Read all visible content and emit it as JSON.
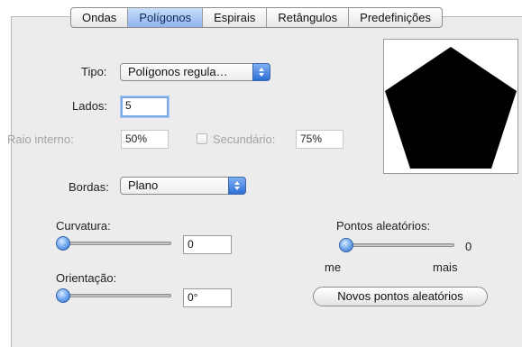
{
  "tabs": [
    {
      "label": "Ondas"
    },
    {
      "label": "Polígonos"
    },
    {
      "label": "Espirais"
    },
    {
      "label": "Retângulos"
    },
    {
      "label": "Predefinições"
    }
  ],
  "active_tab": "Polígonos",
  "type": {
    "label": "Tipo:",
    "value": "Polígonos regula…"
  },
  "sides": {
    "label": "Lados:",
    "value": "5"
  },
  "inner_radius": {
    "label": "Raio interno:",
    "value": "50%"
  },
  "secondary": {
    "label": "Secundário:",
    "value": "75%",
    "checked": false
  },
  "borders": {
    "label": "Bordas:",
    "value": "Plano"
  },
  "curvature": {
    "label": "Curvatura:",
    "value": "0",
    "level": 0
  },
  "orientation": {
    "label": "Orientação:",
    "value": "0°",
    "level": 0
  },
  "random_points": {
    "label": "Pontos aleatórios:",
    "value": "0",
    "level": 0,
    "min_label": "me",
    "max_label": "mais",
    "button_label": "Novos pontos aleatórios"
  },
  "colors": {
    "accent": "#4a86e8",
    "shape": "#000000"
  }
}
